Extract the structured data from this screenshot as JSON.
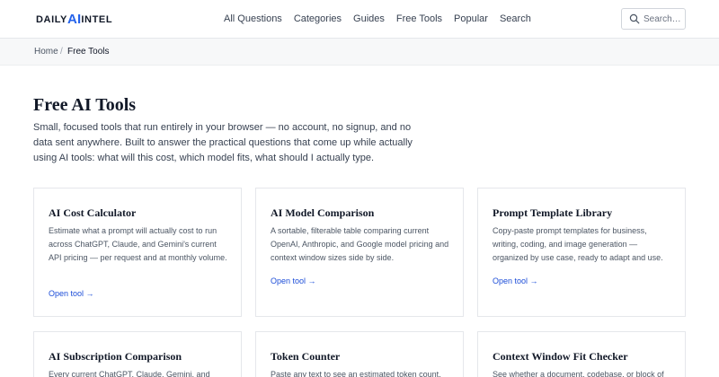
{
  "header": {
    "logo_left": "DAILY",
    "logo_ai": "AI",
    "logo_right": "INTEL",
    "nav": [
      "All Questions",
      "Categories",
      "Guides",
      "Free Tools",
      "Popular",
      "Search"
    ],
    "search_placeholder": "Search…"
  },
  "breadcrumb": {
    "home": "Home",
    "separator": "/",
    "current": "Free Tools"
  },
  "page": {
    "title": "Free AI Tools",
    "intro": "Small, focused tools that run entirely in your browser — no account, no signup, and no data sent anywhere. Built to answer the practical questions that come up while actually using AI tools: what will this cost, which model fits, what should I actually type."
  },
  "tools": [
    {
      "title": "AI Cost Calculator",
      "desc": "Estimate what a prompt will actually cost to run across ChatGPT, Claude, and Gemini's current API pricing — per request and at monthly volume.",
      "link": "Open tool →"
    },
    {
      "title": "AI Model Comparison",
      "desc": "A sortable, filterable table comparing current OpenAI, Anthropic, and Google model pricing and context window sizes side by side.",
      "link": "Open tool →"
    },
    {
      "title": "Prompt Template Library",
      "desc": "Copy-paste prompt templates for business, writing, coding, and image generation — organized by use case, ready to adapt and use.",
      "link": "Open tool →"
    },
    {
      "title": "AI Subscription Comparison",
      "desc": "Every current ChatGPT, Claude, Gemini, and",
      "link": ""
    },
    {
      "title": "Token Counter",
      "desc": "Paste any text to see an estimated token count,",
      "link": ""
    },
    {
      "title": "Context Window Fit Checker",
      "desc": "See whether a document, codebase, or block of",
      "link": ""
    }
  ],
  "colors": {
    "accent": "#2563eb",
    "link": "#1d4ed8",
    "breadcrumb_bg": "#f7f8f9"
  }
}
